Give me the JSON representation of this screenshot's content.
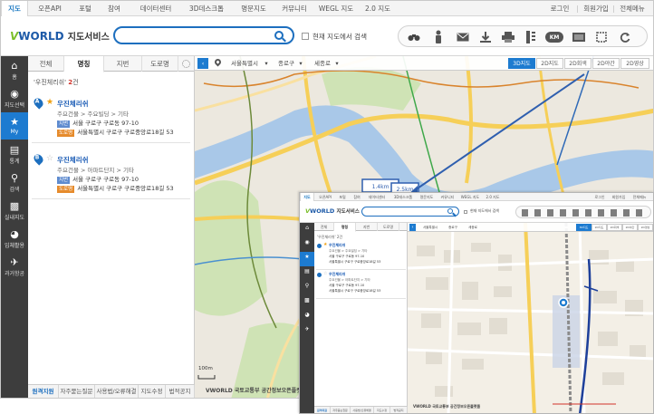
{
  "top_nav": {
    "items": [
      "지도",
      "오픈API",
      "포털",
      "참여",
      "데이터센터",
      "3D데스크톱",
      "명문지도",
      "커뮤니티",
      "WEGL 지도",
      "2.0 지도"
    ],
    "utility": [
      "로그인",
      "회원가입",
      "전체메뉴"
    ]
  },
  "brand": {
    "v": "V",
    "word": "WORLD",
    "service": "지도서비스"
  },
  "search": {
    "value": "",
    "scope_label": "현재 지도에서 검색"
  },
  "toolbar": {
    "icons": [
      "binoculars-icon",
      "person-icon",
      "mail-icon",
      "download-icon",
      "print-icon",
      "ruler-icon",
      "distance-km-icon",
      "area-measure-icon",
      "select-box-icon",
      "refresh-icon"
    ],
    "km_label": "KM"
  },
  "sidebar": {
    "items": [
      {
        "label": "홈",
        "icon": "home-icon"
      },
      {
        "label": "지도선택",
        "icon": "map-pin-icon"
      },
      {
        "label": "My",
        "icon": "star-icon"
      },
      {
        "label": "통계",
        "icon": "bar-chart-icon"
      },
      {
        "label": "검색",
        "icon": "search-icon"
      },
      {
        "label": "실내지도",
        "icon": "indoor-icon"
      },
      {
        "label": "입체활용",
        "icon": "globe-icon"
      },
      {
        "label": "과거항공",
        "icon": "plane-icon"
      }
    ]
  },
  "panel": {
    "tabs": [
      "전체",
      "명칭",
      "지번",
      "도로명"
    ],
    "summary_query": "'우진체리쉬'",
    "summary_count": "2",
    "summary_unit": "건",
    "results": [
      {
        "marker": "A",
        "name": "우진체리쉬",
        "category": "주요건물 > 주요빌딩 > 기타",
        "jibun_badge": "지번",
        "jibun": "서울 구로구 구로동 97-10",
        "road_badge": "도로명",
        "road": "서울특별시 구로구 구로중앙로18길 53"
      },
      {
        "marker": "B",
        "name": "우진체리쉬",
        "category": "주요건물 > 아파트단지 > 기타",
        "jibun_badge": "지번",
        "jibun": "서울 구로구 구로동 97-10",
        "road_badge": "도로명",
        "road": "서울특별시 구로구 구로중앙로18길 53"
      }
    ],
    "bottom_links": [
      "원격지원",
      "자주묻는질문",
      "사용법/오류해결",
      "지도수정",
      "법적공지"
    ]
  },
  "map_toolbar": {
    "city": "서울특별시",
    "district": "종로구",
    "dong": "세종로",
    "modes": [
      "3D지도",
      "2D지도",
      "2D회색",
      "2D야간",
      "2D영상"
    ],
    "active_mode": "3D지도"
  },
  "map": {
    "scale_labels": [
      "1.4km",
      "2.5km"
    ],
    "copyright": "VWORLD 국토교통부 공간정보오픈플랫폼",
    "zoom_label": "100m"
  },
  "inset": {
    "search_scope": "현재 지도에서 검색",
    "summary": "'우진체리쉬' 2건",
    "map_city": "서울특별시",
    "map_district": "종로구",
    "map_dong": "세종로"
  },
  "colors": {
    "accent": "#1d7bd0",
    "sidebar_bg": "#3d3d3d",
    "river": "#a9c8e8",
    "major_road": "#f6cf58",
    "park": "#cfe3b5",
    "count_red": "#d0332a"
  }
}
